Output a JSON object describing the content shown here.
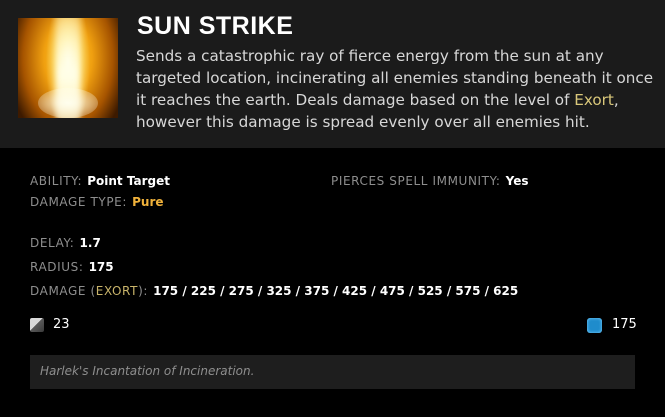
{
  "ability": {
    "name": "SUN STRIKE",
    "icon": "sun-strike-icon",
    "description_parts": [
      "Sends a catastrophic ray of fierce energy from the sun at any targeted location, incinerating all enemies standing beneath it once it reaches the earth. Deals damage based on the level of ",
      "Exort",
      ", however this damage is spread evenly over all enemies hit."
    ]
  },
  "stats": {
    "ability_label": "ABILITY:",
    "ability_value": "Point Target",
    "damage_type_label": "DAMAGE TYPE:",
    "damage_type_value": "Pure",
    "pierces_label": "PIERCES SPELL IMMUNITY:",
    "pierces_value": "Yes",
    "delay_label": "DELAY:",
    "delay_value": "1.7",
    "radius_label": "RADIUS:",
    "radius_value": "175",
    "damage_label_prefix": "DAMAGE (",
    "damage_label_exort": "EXORT",
    "damage_label_suffix": "):",
    "damage_value": "175 / 225 / 275 / 325 / 375 / 425 / 475 / 525 / 575 / 625"
  },
  "costs": {
    "cooldown": "23",
    "cooldown_icon": "cooldown-icon",
    "mana": "175",
    "mana_icon": "mana-icon",
    "mana_color": "#1f8ccc"
  },
  "lore": "Harlek's Incantation of Incineration.",
  "colors": {
    "header_bg": "#1b1b1b",
    "body_bg": "#000000",
    "pure_damage": "#f0b23b",
    "exort": "#d9c77a"
  }
}
